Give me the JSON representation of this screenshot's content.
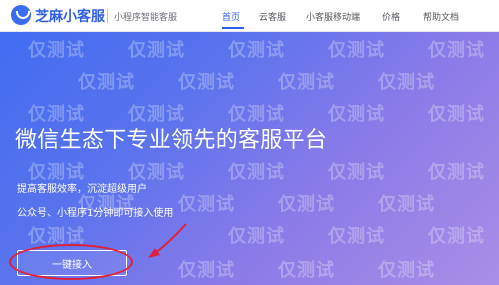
{
  "header": {
    "brand": "芝麻小客服",
    "subtitle": "小程序智能客服",
    "nav": [
      {
        "label": "首页",
        "active": true
      },
      {
        "label": "云客服",
        "active": false
      },
      {
        "label": "小客服移动端",
        "active": false
      },
      {
        "label": "价格",
        "active": false
      },
      {
        "label": "帮助文档",
        "active": false
      }
    ]
  },
  "hero": {
    "headline": "微信生态下专业领先的客服平台",
    "line1": "提高客服效率，沉淀超级用户",
    "line2": "公众号、小程序1分钟即可接入使用",
    "cta_label": "一键接入"
  },
  "watermark": {
    "text": "仅测试"
  },
  "colors": {
    "accent": "#2e5fe8",
    "annotation": "#e0203a"
  }
}
